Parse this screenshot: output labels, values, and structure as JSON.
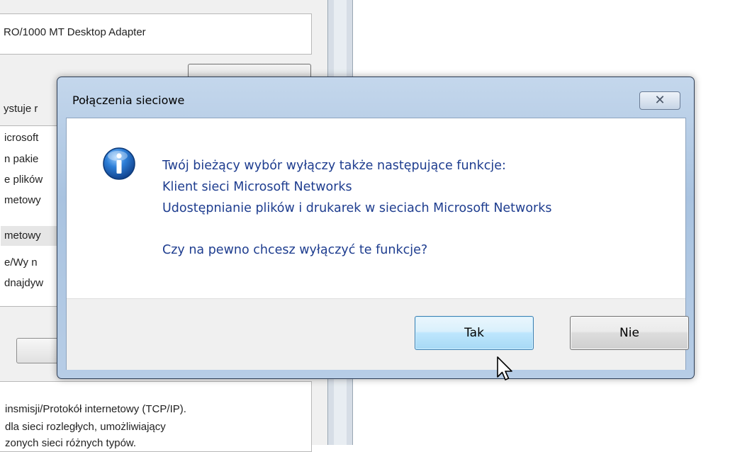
{
  "background_window": {
    "adapter_name": "RO/1000 MT Desktop Adapter",
    "uses_label": "ystuje r",
    "components": [
      "icrosoft",
      "n pakie",
      "e plików",
      "metowy",
      "metowy",
      "e/Wy n",
      "dnajdyw"
    ],
    "description_lines": [
      "insmisji/Protokół internetowy (TCP/IP).",
      "dla sieci rozległych, umożliwiający",
      "zonych sieci różnych typów."
    ]
  },
  "dialog": {
    "title": "Połączenia sieciowe",
    "close_symbol": "✕",
    "icon": "info-icon",
    "message_lines": [
      "Twój bieżący wybór wyłączy także następujące funkcje:",
      "Klient sieci Microsoft Networks",
      "Udostępnianie plików i drukarek w sieciach Microsoft Networks",
      "Czy na pewno chcesz wyłączyć te funkcje?"
    ],
    "buttons": {
      "yes_label": "Tak",
      "no_label": "Nie"
    }
  },
  "colors": {
    "message_text": "#1e3d8f",
    "frame": "#a9c3e0",
    "default_button_border": "#3c7fb1"
  }
}
